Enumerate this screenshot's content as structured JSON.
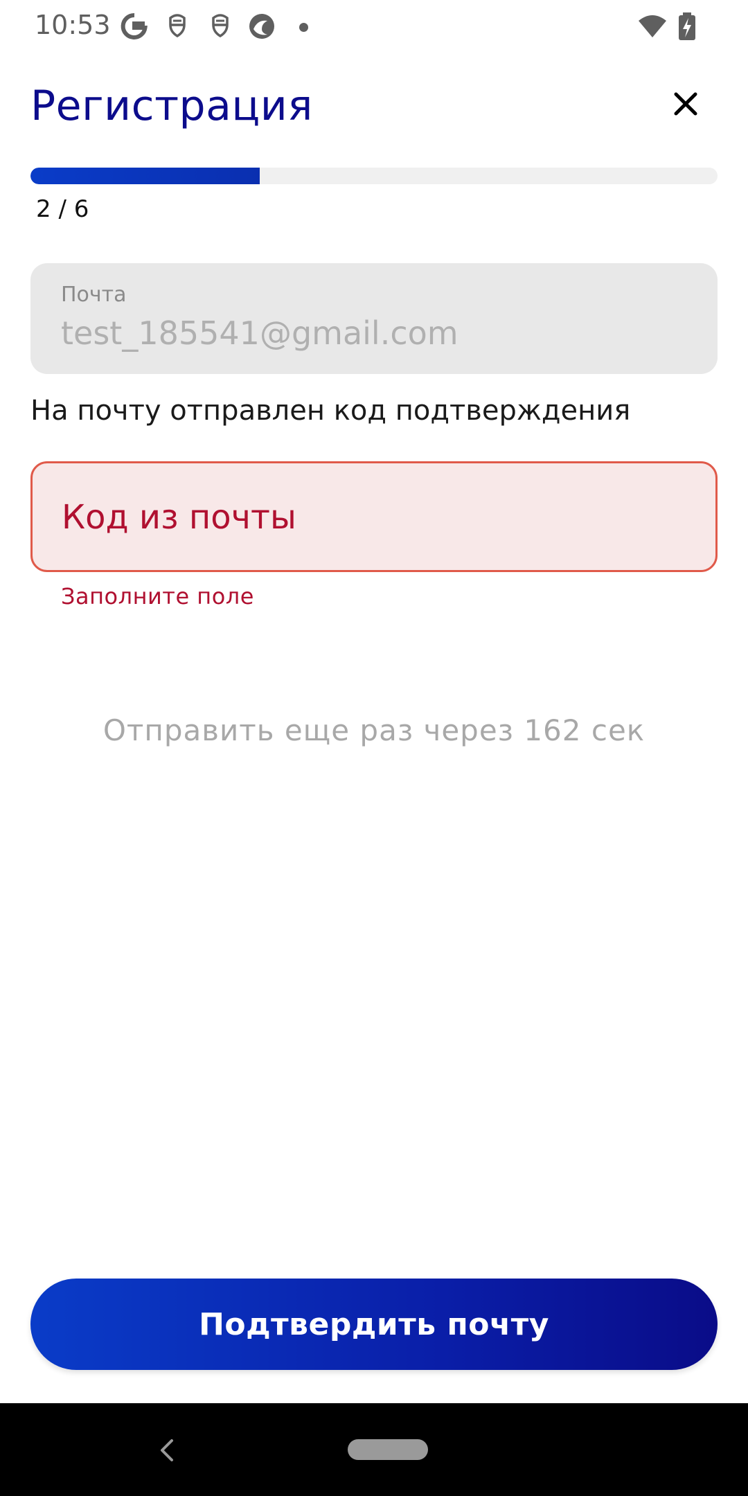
{
  "status_bar": {
    "time": "10:53",
    "icons": [
      "google-icon",
      "notification-icon",
      "notification-icon",
      "browser-icon",
      "dot-icon",
      "wifi-icon",
      "battery-charging-icon"
    ]
  },
  "header": {
    "title": "Регистрация",
    "close_icon": "close-icon"
  },
  "progress": {
    "label": "2 / 6",
    "current_step": 2,
    "total_steps": 6,
    "accent_color": "#0a3cc8"
  },
  "email_field": {
    "label": "Почта",
    "value": "test_185541@gmail.com"
  },
  "info_text": "На почту отправлен код подтверждения",
  "code_field": {
    "placeholder": "Код из почты",
    "error": "Заполните поле",
    "error_color": "#b01030"
  },
  "resend": {
    "text": "Отправить еще раз через 162 сек"
  },
  "confirm_button": {
    "label": "Подтвердить почту"
  },
  "nav_bar": {
    "back_icon": "back-icon",
    "home_icon": "home-pill-icon"
  }
}
